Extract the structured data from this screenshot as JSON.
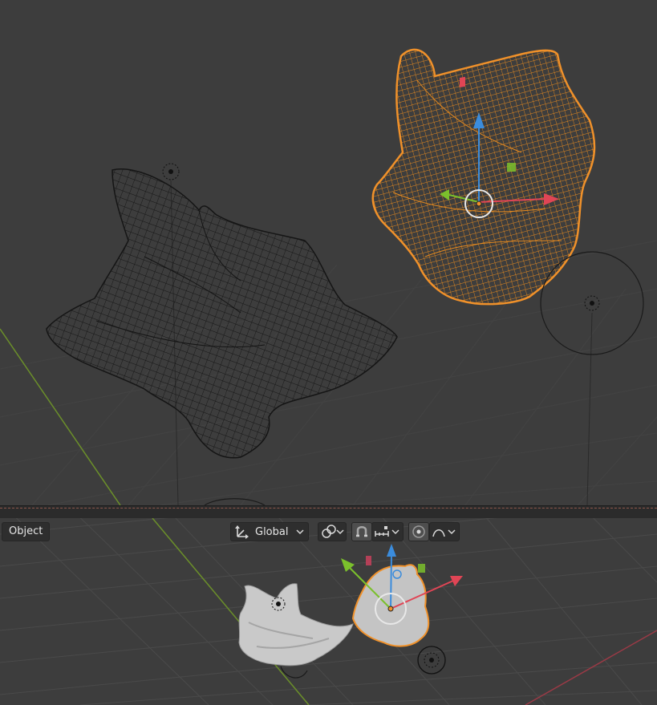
{
  "header": {
    "mode_label": "Object",
    "orientation_label": "Global"
  },
  "icons": {
    "orientation": "transform-orientation-icon",
    "pivot": "pivot-point-icon",
    "snap": "snap-magnet-icon",
    "snap_target": "snap-increment-icon",
    "proportional": "proportional-editing-icon",
    "falloff": "falloff-curve-icon",
    "chevron": "chevron-down-icon"
  },
  "colors": {
    "viewport_bg": "#3d3d3d",
    "grid_line": "#4a4a4a",
    "selection_orange": "#f0912a",
    "axis_x": "#e04555",
    "axis_y": "#7bc02c",
    "axis_z": "#3b8cdc",
    "wire_dark": "#1a1a1a",
    "solid_mesh": "#c8c8c8"
  }
}
